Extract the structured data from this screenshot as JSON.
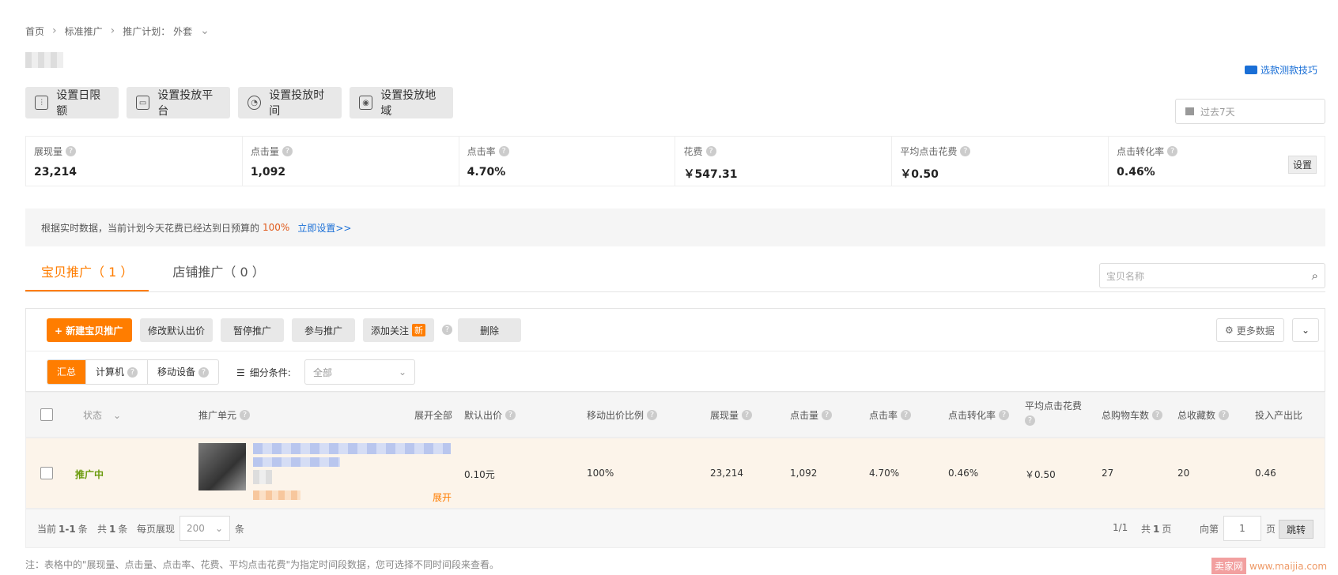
{
  "breadcrumb": {
    "home": "首页",
    "standard": "标准推广",
    "plan_label": "推广计划：",
    "plan_name": "外套"
  },
  "top_link": "选款测款技巧",
  "top_buttons": [
    "设置日限额",
    "设置投放平台",
    "设置投放时间",
    "设置投放地域"
  ],
  "date_range": "过去7天",
  "stats": [
    {
      "label": "展现量",
      "value": "23,214"
    },
    {
      "label": "点击量",
      "value": "1,092"
    },
    {
      "label": "点击率",
      "value": "4.70%"
    },
    {
      "label": "花费",
      "value": "￥547.31"
    },
    {
      "label": "平均点击花费",
      "value": "￥0.50"
    },
    {
      "label": "点击转化率",
      "value": "0.46%"
    }
  ],
  "stats_setting": "设置",
  "notice": {
    "text": "根据实时数据，当前计划今天花费已经达到日预算的",
    "percent": "100%",
    "link": "立即设置>>"
  },
  "tabs": [
    "宝贝推广（ 1 ）",
    "店铺推广（ 0 ）"
  ],
  "search_placeholder": "宝贝名称",
  "toolbar": {
    "new": "+ 新建宝贝推广",
    "modify_bid": "修改默认出价",
    "pause": "暂停推广",
    "join": "参与推广",
    "follow": "添加关注",
    "new_badge": "新",
    "delete": "删除",
    "more_data": "更多数据"
  },
  "filter": {
    "segments": [
      "汇总",
      "计算机",
      "移动设备"
    ],
    "condition_label": "细分条件:",
    "condition_value": "全部"
  },
  "table": {
    "headers": {
      "status": "状态",
      "unit": "推广单元",
      "expand_all": "展开全部",
      "bid": "默认出价",
      "mobile_ratio": "移动出价比例",
      "impressions": "展现量",
      "clicks": "点击量",
      "ctr": "点击率",
      "cvr": "点击转化率",
      "cpc": "平均点击花费",
      "cart": "总购物车数",
      "fav": "总收藏数",
      "roi": "投入产出比"
    },
    "rows": [
      {
        "status": "推广中",
        "expand": "展开",
        "bid": "0.10元",
        "mobile_ratio": "100%",
        "impressions": "23,214",
        "clicks": "1,092",
        "ctr": "4.70%",
        "cvr": "0.46%",
        "cpc": "￥0.50",
        "cart": "27",
        "fav": "20",
        "roi": "0.46"
      }
    ]
  },
  "pager": {
    "current_prefix": "当前",
    "current_range": "1-1",
    "current_suffix": "条",
    "total_prefix": "共",
    "total_count": "1",
    "total_suffix": "条",
    "per_page_label": "每页展现",
    "per_page": "200",
    "per_page_unit": "条",
    "page_info": "1/1",
    "pages_prefix": "共",
    "pages_count": "1",
    "pages_suffix": "页",
    "goto_label": "向第",
    "goto_value": "1",
    "goto_unit": "页",
    "jump": "跳转"
  },
  "footnote": "注：表格中的\"展现量、点击量、点击率、花费、平均点击花费\"为指定时间段数据，您可选择不同时间段来查看。",
  "watermark": {
    "box": "卖家网",
    "url": "www.maijia.com"
  }
}
